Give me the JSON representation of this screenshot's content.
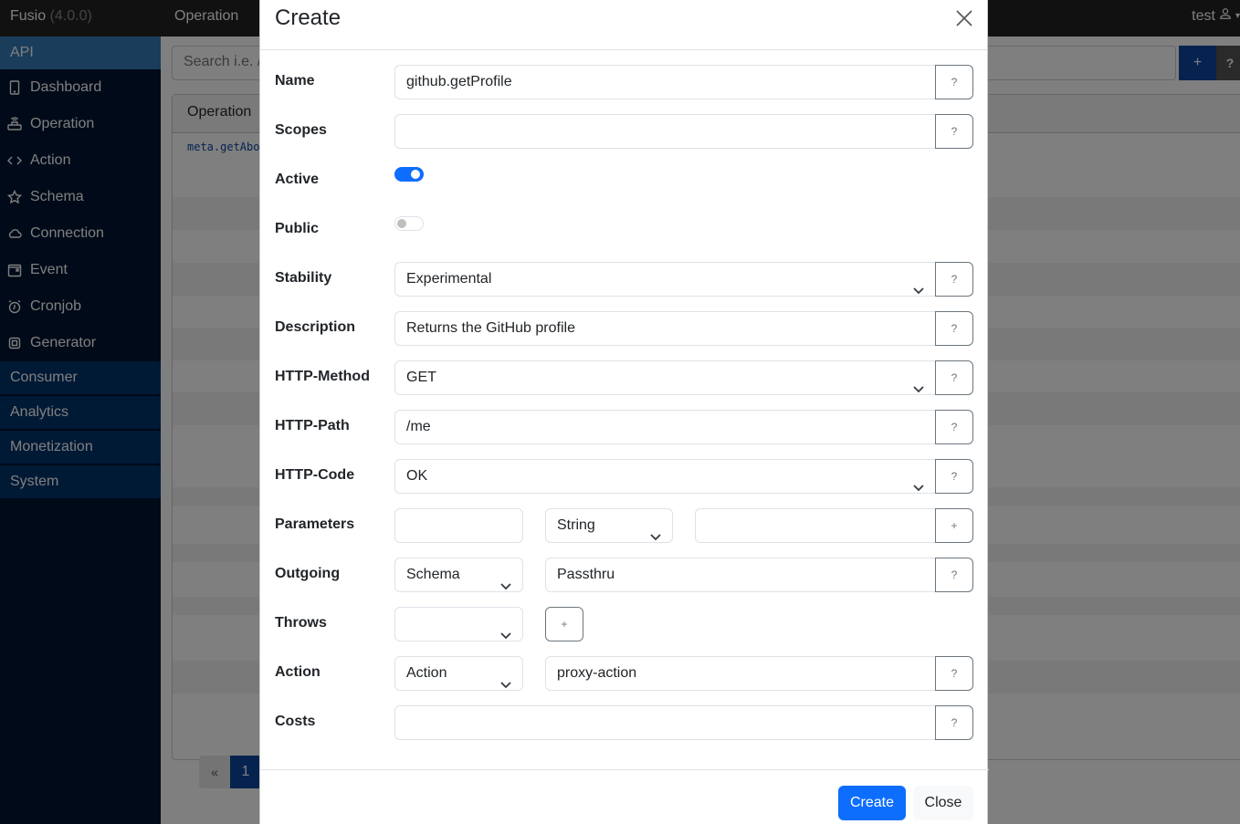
{
  "app": {
    "brand": "Fusio",
    "version": "(4.0.0)",
    "top_nav": "Operation",
    "user": "test"
  },
  "sidebar": {
    "api_section": "API",
    "items": [
      {
        "label": "Dashboard",
        "icon": "tablet-icon"
      },
      {
        "label": "Operation",
        "icon": "router-icon"
      },
      {
        "label": "Action",
        "icon": "code-icon"
      },
      {
        "label": "Schema",
        "icon": "star-icon"
      },
      {
        "label": "Connection",
        "icon": "cloud-icon"
      },
      {
        "label": "Event",
        "icon": "calendar-icon"
      },
      {
        "label": "Cronjob",
        "icon": "alarm-icon"
      },
      {
        "label": "Generator",
        "icon": "cpu-icon"
      }
    ],
    "sections": [
      "Consumer",
      "Analytics",
      "Monetization",
      "System"
    ]
  },
  "main": {
    "search_placeholder": "Search i.e. /",
    "add_button": "+",
    "help_button": "?",
    "panel_title": "Operation",
    "rows": [
      "meta.getAbout"
    ],
    "pagination": {
      "prev": "«",
      "current": "1"
    }
  },
  "modal": {
    "title": "Create",
    "fields": {
      "name": {
        "label": "Name",
        "value": "github.getProfile"
      },
      "scopes": {
        "label": "Scopes",
        "value": ""
      },
      "active": {
        "label": "Active",
        "checked": true
      },
      "public": {
        "label": "Public",
        "checked": false
      },
      "stability": {
        "label": "Stability",
        "value": "Experimental"
      },
      "description": {
        "label": "Description",
        "value": "Returns the GitHub profile"
      },
      "http_method": {
        "label": "HTTP-Method",
        "value": "GET"
      },
      "http_path": {
        "label": "HTTP-Path",
        "value": "/me"
      },
      "http_code": {
        "label": "HTTP-Code",
        "value": "OK"
      },
      "parameters": {
        "label": "Parameters",
        "name": "",
        "type": "String",
        "description": ""
      },
      "outgoing": {
        "label": "Outgoing",
        "type": "Schema",
        "value": "Passthru"
      },
      "throws": {
        "label": "Throws",
        "code": ""
      },
      "action": {
        "label": "Action",
        "type": "Action",
        "value": "proxy-action"
      },
      "costs": {
        "label": "Costs",
        "value": ""
      }
    },
    "help_label": "?",
    "add_label": "+",
    "buttons": {
      "create": "Create",
      "close": "Close"
    }
  }
}
